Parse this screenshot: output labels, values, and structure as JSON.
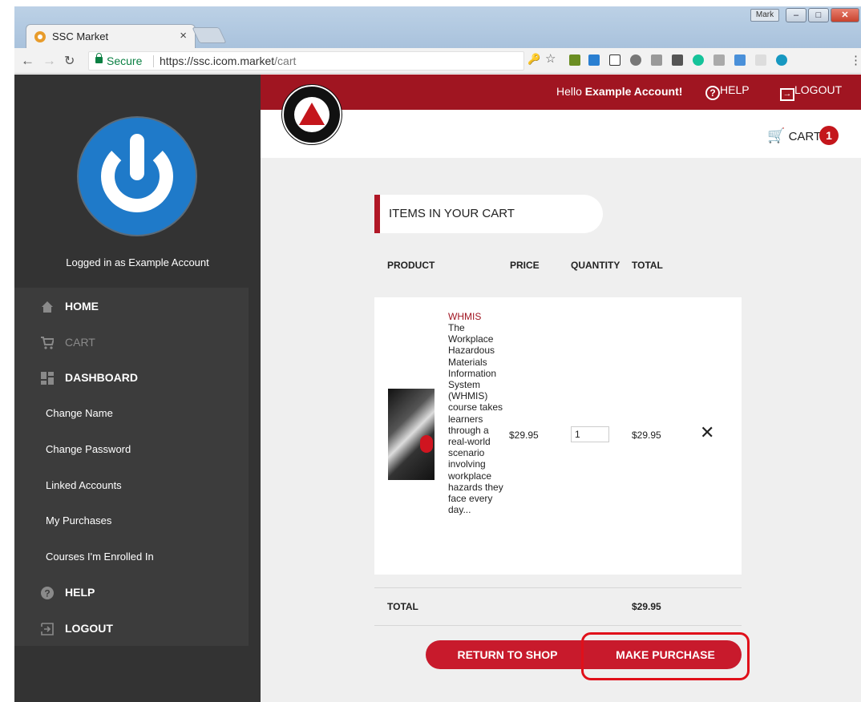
{
  "browser": {
    "tab_title": "SSC Market",
    "tab_close": "×",
    "user_button": "Mark",
    "url_secure": "Secure",
    "url_base": "https://ssc.icom.market",
    "url_path": "/cart"
  },
  "header": {
    "greeting_prefix": "Hello ",
    "greeting_name": "Example Account!",
    "help_label": "HELP",
    "logout_label": "LOGOUT",
    "cart_label": "CART",
    "cart_count": "1"
  },
  "sidebar": {
    "logged_in_text": "Logged in as Example Account",
    "items": [
      {
        "label": "HOME"
      },
      {
        "label": "CART"
      },
      {
        "label": "DASHBOARD"
      },
      {
        "label": "Change Name"
      },
      {
        "label": "Change Password"
      },
      {
        "label": "Linked Accounts"
      },
      {
        "label": "My Purchases"
      },
      {
        "label": "Courses I'm Enrolled In"
      },
      {
        "label": "HELP"
      },
      {
        "label": "LOGOUT"
      }
    ]
  },
  "cart": {
    "heading": "ITEMS IN YOUR CART",
    "columns": {
      "product": "PRODUCT",
      "price": "PRICE",
      "quantity": "QUANTITY",
      "total": "TOTAL"
    },
    "item": {
      "name": "WHMIS",
      "description": "The Workplace Hazardous Materials Information System (WHMIS) course takes learners through a real-world scenario involving workplace hazards they face every day...",
      "price": "$29.95",
      "quantity": "1",
      "total": "$29.95",
      "remove": "✕"
    },
    "total_label": "TOTAL",
    "total_value": "$29.95",
    "return_button": "RETURN TO SHOP",
    "purchase_button": "MAKE PURCHASE"
  },
  "colors": {
    "accent": "#c81a2c",
    "header": "#a01521",
    "sidebar": "#333333"
  }
}
